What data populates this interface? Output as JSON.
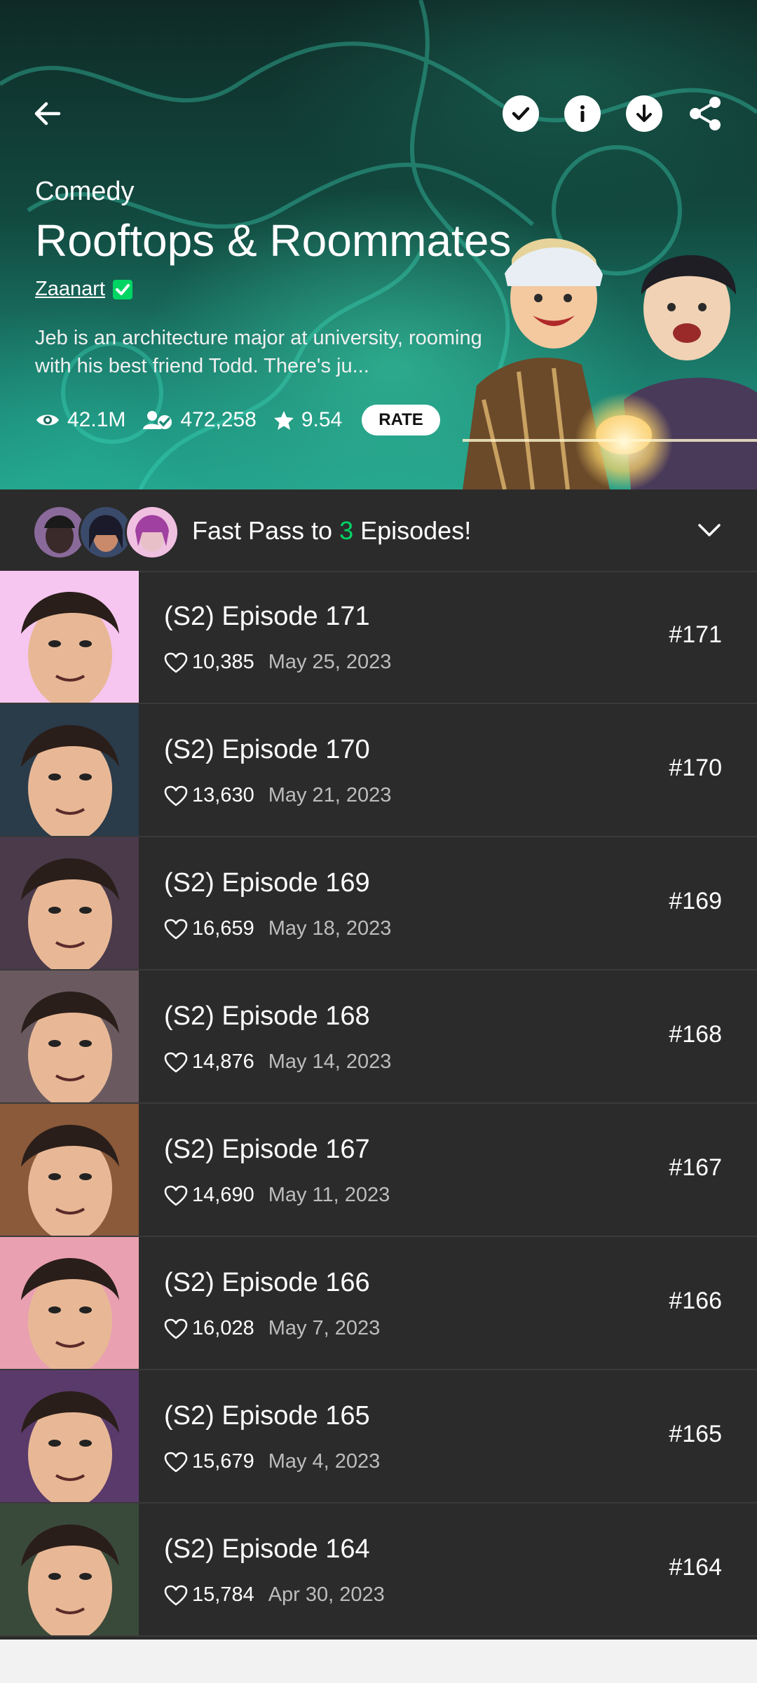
{
  "hero": {
    "genre": "Comedy",
    "title": "Rooftops & Roommates",
    "author": "Zaanart",
    "description": "Jeb is an architecture major at university, rooming with his best friend Todd. There's ju...",
    "views": "42.1M",
    "subscribers": "472,258",
    "rating": "9.54",
    "rate_label": "RATE"
  },
  "icons": {
    "back": "arrow-left-icon",
    "subscribe": "check-icon",
    "info": "info-icon",
    "download": "download-icon",
    "share": "share-icon"
  },
  "fastpass": {
    "prefix": "Fast Pass to ",
    "count": "3",
    "suffix": " Episodes!"
  },
  "episodes": [
    {
      "title": "(S2) Episode 171",
      "likes": "10,385",
      "date": "May 25, 2023",
      "number": "#171",
      "thumb_color": "#f6c6f0"
    },
    {
      "title": "(S2) Episode 170",
      "likes": "13,630",
      "date": "May 21, 2023",
      "number": "#170",
      "thumb_color": "#2a3b4a"
    },
    {
      "title": "(S2) Episode 169",
      "likes": "16,659",
      "date": "May 18, 2023",
      "number": "#169",
      "thumb_color": "#4a3a4a"
    },
    {
      "title": "(S2) Episode 168",
      "likes": "14,876",
      "date": "May 14, 2023",
      "number": "#168",
      "thumb_color": "#6a5a60"
    },
    {
      "title": "(S2) Episode 167",
      "likes": "14,690",
      "date": "May 11, 2023",
      "number": "#167",
      "thumb_color": "#8a5a3a"
    },
    {
      "title": "(S2) Episode 166",
      "likes": "16,028",
      "date": "May 7, 2023",
      "number": "#166",
      "thumb_color": "#e9a0b0"
    },
    {
      "title": "(S2) Episode 165",
      "likes": "15,679",
      "date": "May 4, 2023",
      "number": "#165",
      "thumb_color": "#5a3a6a"
    },
    {
      "title": "(S2) Episode 164",
      "likes": "15,784",
      "date": "Apr 30, 2023",
      "number": "#164",
      "thumb_color": "#3a4a3a"
    }
  ],
  "colors": {
    "accent_green": "#00d564",
    "background": "#2b2b2b"
  }
}
